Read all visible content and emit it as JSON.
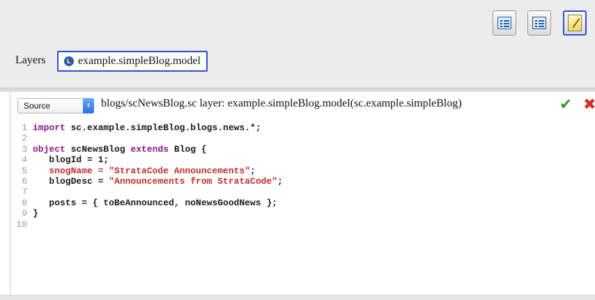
{
  "toolbar": {
    "buttons": [
      {
        "name": "list-view-button",
        "icon": "list-icon"
      },
      {
        "name": "detail-list-button",
        "icon": "detail-list-icon"
      },
      {
        "name": "edit-button",
        "icon": "pencil-icon",
        "selected": true
      }
    ]
  },
  "layers": {
    "label": "Layers",
    "chip_icon_letter": "L",
    "chip_name": "example.simpleBlog.model"
  },
  "editor": {
    "view_select": "Source",
    "path": "blogs/scNewsBlog.sc layer: example.simpleBlog.model(sc.example.simpleBlog)",
    "ok_glyph": "✔",
    "cancel_glyph": "✖",
    "lines": [
      {
        "n": "1",
        "parts": [
          {
            "t": "import",
            "c": "kw"
          },
          {
            "t": " sc.example.simpleBlog.blogs.news.*;",
            "c": ""
          }
        ]
      },
      {
        "n": "2",
        "parts": []
      },
      {
        "n": "3",
        "parts": [
          {
            "t": "object",
            "c": "kw"
          },
          {
            "t": " scNewsBlog ",
            "c": ""
          },
          {
            "t": "extends",
            "c": "kw"
          },
          {
            "t": " Blog {",
            "c": ""
          }
        ]
      },
      {
        "n": "4",
        "parts": [
          {
            "t": "   blogId = 1;",
            "c": ""
          }
        ]
      },
      {
        "n": "5",
        "parts": [
          {
            "t": "   snogName = ",
            "c": "err"
          },
          {
            "t": "\"StrataCode Announcements\"",
            "c": "str"
          },
          {
            "t": ";",
            "c": ""
          }
        ]
      },
      {
        "n": "6",
        "parts": [
          {
            "t": "   blogDesc = ",
            "c": ""
          },
          {
            "t": "\"Announcements from StrataCode\"",
            "c": "str"
          },
          {
            "t": ";",
            "c": ""
          }
        ]
      },
      {
        "n": "7",
        "parts": []
      },
      {
        "n": "8",
        "parts": [
          {
            "t": "   posts = { toBeAnnounced, noNewsGoodNews };",
            "c": ""
          }
        ]
      },
      {
        "n": "9",
        "parts": [
          {
            "t": "}",
            "c": ""
          }
        ]
      },
      {
        "n": "10",
        "parts": []
      }
    ]
  }
}
